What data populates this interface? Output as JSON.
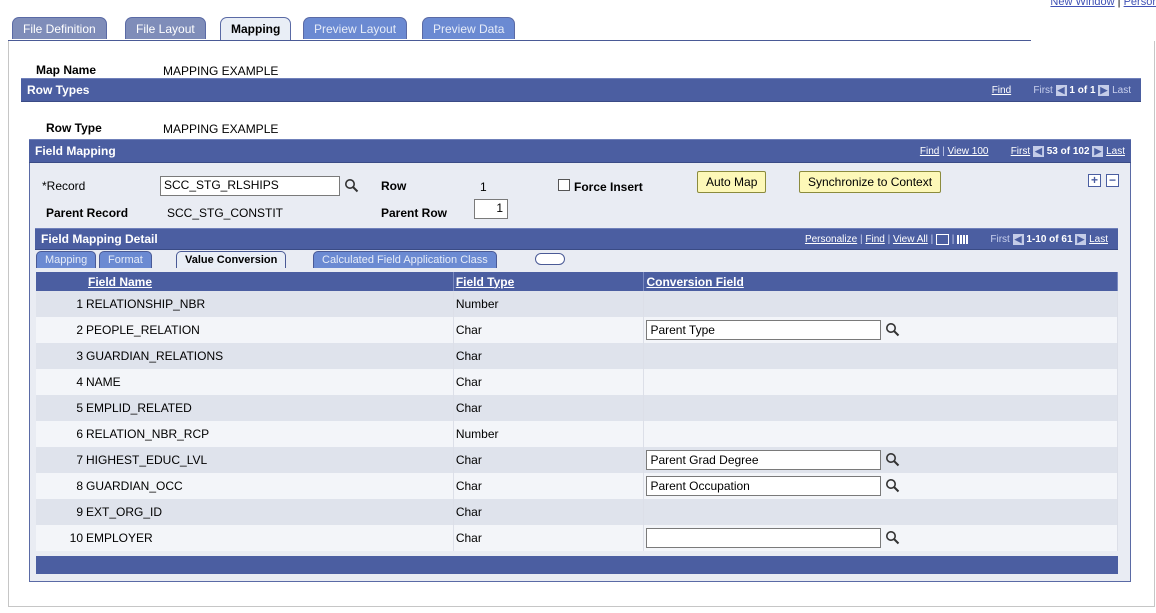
{
  "top_links": {
    "new_window": "New Window",
    "separator": " | ",
    "personalize": "Persor"
  },
  "tabs": [
    {
      "label": "File Definition",
      "active": false
    },
    {
      "label": "File Layout",
      "active": false
    },
    {
      "label": "Mapping",
      "active": true
    },
    {
      "label": "Preview Layout",
      "active": false
    },
    {
      "label": "Preview Data",
      "active": false
    }
  ],
  "map_name": {
    "label": "Map Name",
    "value": "MAPPING EXAMPLE"
  },
  "row_types": {
    "title": "Row Types",
    "find": "Find",
    "first": "First",
    "position": "1 of 1",
    "last": "Last",
    "row_type_label": "Row Type",
    "row_type_value": "MAPPING EXAMPLE"
  },
  "field_mapping": {
    "title": "Field Mapping",
    "find": "Find",
    "sep": " | ",
    "view": "View 100",
    "first": "First",
    "position": "53 of 102",
    "last": "Last",
    "record_label": "*Record",
    "record_value": "SCC_STG_RLSHIPS",
    "row_label": "Row",
    "row_value": "1",
    "force_insert_label": "Force Insert",
    "force_insert_checked": false,
    "auto_map": "Auto Map",
    "sync": "Synchronize to Context",
    "parent_record_label": "Parent Record",
    "parent_record_value": "SCC_STG_CONSTIT",
    "parent_row_label": "Parent Row",
    "parent_row_value": "1",
    "add_symbol": "+",
    "delete_symbol": "−"
  },
  "detail": {
    "title": "Field Mapping Detail",
    "personalize": "Personalize",
    "find": "Find",
    "view_all": "View All",
    "first": "First",
    "position": "1-10 of 61",
    "last": "Last",
    "sep": " | ",
    "subtabs": [
      {
        "label": "Mapping",
        "active": false
      },
      {
        "label": "Format",
        "active": false
      },
      {
        "label": "Value Conversion",
        "active": true
      },
      {
        "label": "Calculated Field Application Class",
        "active": false
      }
    ],
    "columns": [
      "Field Name",
      "Field Type",
      "Conversion Field"
    ],
    "rows": [
      {
        "num": "1",
        "name": "RELATIONSHIP_NBR",
        "type": "Number",
        "conversion": null
      },
      {
        "num": "2",
        "name": "PEOPLE_RELATION",
        "type": "Char",
        "conversion": "Parent Type"
      },
      {
        "num": "3",
        "name": "GUARDIAN_RELATIONS",
        "type": "Char",
        "conversion": null
      },
      {
        "num": "4",
        "name": "NAME",
        "type": "Char",
        "conversion": null
      },
      {
        "num": "5",
        "name": "EMPLID_RELATED",
        "type": "Char",
        "conversion": null
      },
      {
        "num": "6",
        "name": "RELATION_NBR_RCP",
        "type": "Number",
        "conversion": null
      },
      {
        "num": "7",
        "name": "HIGHEST_EDUC_LVL",
        "type": "Char",
        "conversion": "Parent Grad Degree"
      },
      {
        "num": "8",
        "name": "GUARDIAN_OCC",
        "type": "Char",
        "conversion": "Parent Occupation"
      },
      {
        "num": "9",
        "name": "EXT_ORG_ID",
        "type": "Char",
        "conversion": null
      },
      {
        "num": "10",
        "name": "EMPLOYER",
        "type": "Char",
        "conversion": ""
      }
    ]
  },
  "colors": {
    "header_blue": "#4b5ea1",
    "button_yellow": "#fdf8b8",
    "row_odd": "#dfe3ec",
    "row_even": "#f3f5f9"
  }
}
